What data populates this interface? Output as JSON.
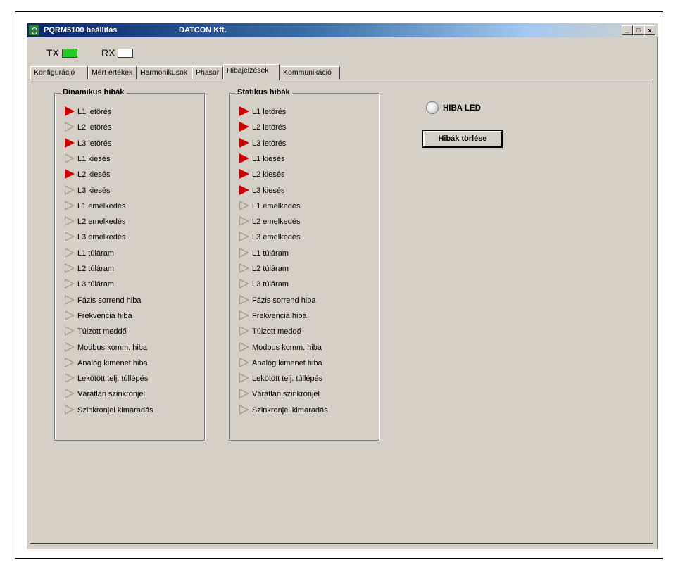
{
  "window": {
    "title": "PQRM5100 beállítás",
    "company": "DATCON Kft.",
    "controls": [
      "_",
      "□",
      "x"
    ]
  },
  "indicators": {
    "tx": {
      "label": "TX",
      "color": "#22cc22"
    },
    "rx": {
      "label": "RX",
      "color": "#ffffff"
    }
  },
  "tabs": [
    {
      "label": "Konfiguráció",
      "active": false
    },
    {
      "label": "Mért értékek",
      "active": false
    },
    {
      "label": "Harmonikusok",
      "active": false
    },
    {
      "label": "Phasor",
      "active": false
    },
    {
      "label": "Hibajelzések",
      "active": true
    },
    {
      "label": "Kommunikáció",
      "active": false
    }
  ],
  "dinamikus": {
    "title": "Dinamikus hibák",
    "items": [
      {
        "label": "L1 letörés",
        "active": true
      },
      {
        "label": "L2 letörés",
        "active": false
      },
      {
        "label": "L3 letörés",
        "active": true
      },
      {
        "label": "L1 kiesés",
        "active": false
      },
      {
        "label": "L2 kiesés",
        "active": true
      },
      {
        "label": "L3 kiesés",
        "active": false
      },
      {
        "label": "L1 emelkedés",
        "active": false
      },
      {
        "label": "L2 emelkedés",
        "active": false
      },
      {
        "label": "L3 emelkedés",
        "active": false
      },
      {
        "label": "L1 túláram",
        "active": false
      },
      {
        "label": "L2 túláram",
        "active": false
      },
      {
        "label": "L3 túláram",
        "active": false
      },
      {
        "label": "Fázis sorrend hiba",
        "active": false
      },
      {
        "label": "Frekvencia hiba",
        "active": false
      },
      {
        "label": "Túlzott meddő",
        "active": false
      },
      {
        "label": "Modbus komm. hiba",
        "active": false
      },
      {
        "label": "Analóg kimenet hiba",
        "active": false
      },
      {
        "label": "Lekötött telj. túllépés",
        "active": false
      },
      {
        "label": "Váratlan szinkronjel",
        "active": false
      },
      {
        "label": "Szinkronjel kimaradás",
        "active": false
      }
    ]
  },
  "statikus": {
    "title": "Statikus hibák",
    "items": [
      {
        "label": "L1 letörés",
        "active": true
      },
      {
        "label": "L2 letörés",
        "active": true
      },
      {
        "label": "L3 letörés",
        "active": true
      },
      {
        "label": "L1 kiesés",
        "active": true
      },
      {
        "label": "L2 kiesés",
        "active": true
      },
      {
        "label": "L3 kiesés",
        "active": true
      },
      {
        "label": "L1 emelkedés",
        "active": false
      },
      {
        "label": "L2 emelkedés",
        "active": false
      },
      {
        "label": "L3 emelkedés",
        "active": false
      },
      {
        "label": "L1 túláram",
        "active": false
      },
      {
        "label": "L2 túláram",
        "active": false
      },
      {
        "label": "L3 túláram",
        "active": false
      },
      {
        "label": "Fázis sorrend hiba",
        "active": false
      },
      {
        "label": "Frekvencia hiba",
        "active": false
      },
      {
        "label": "Túlzott meddő",
        "active": false
      },
      {
        "label": "Modbus komm. hiba",
        "active": false
      },
      {
        "label": "Analóg kimenet hiba",
        "active": false
      },
      {
        "label": "Lekötött telj. túllépés",
        "active": false
      },
      {
        "label": "Váratlan szinkronjel",
        "active": false
      },
      {
        "label": "Szinkronjel kimaradás",
        "active": false
      }
    ]
  },
  "hiba_led": {
    "label": "HIBA LED",
    "lit": false
  },
  "clear_button": {
    "label": "Hibák törlése"
  },
  "colors": {
    "active_marker": "#cc0000",
    "inactive_marker": "#a09c94",
    "face": "#d4d0c8"
  }
}
